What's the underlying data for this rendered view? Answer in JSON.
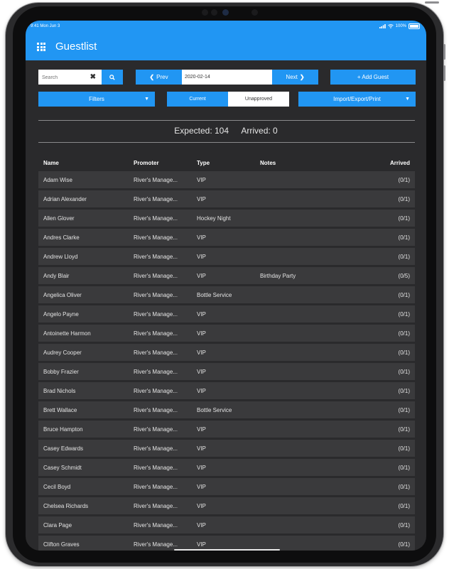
{
  "status_bar": {
    "time": "9:41 Mon Jun 3",
    "battery": "100%"
  },
  "app": {
    "title": "Guestlist"
  },
  "toolbar": {
    "search_placeholder": "Search",
    "prev_label": "Prev",
    "date_value": "2020-02-14",
    "next_label": "Next",
    "add_guest_label": "+ Add Guest",
    "filters_label": "Filters",
    "segment": {
      "current": "Current",
      "unapproved": "Unapproved",
      "selected": "Unapproved"
    },
    "import_export_label": "Import/Export/Print"
  },
  "summary": {
    "expected": "Expected: 104",
    "arrived": "Arrived: 0"
  },
  "table": {
    "headers": {
      "name": "Name",
      "promoter": "Promoter",
      "type": "Type",
      "notes": "Notes",
      "arrived": "Arrived"
    },
    "rows": [
      {
        "name": "Adam Wise",
        "promoter": "River's Manage...",
        "type": "VIP",
        "notes": "",
        "arrived": "(0/1)"
      },
      {
        "name": "Adrian Alexander",
        "promoter": "River's Manage...",
        "type": "VIP",
        "notes": "",
        "arrived": "(0/1)"
      },
      {
        "name": "Allen Glover",
        "promoter": "River's Manage...",
        "type": "Hockey Night",
        "notes": "",
        "arrived": "(0/1)"
      },
      {
        "name": "Andres Clarke",
        "promoter": "River's Manage...",
        "type": "VIP",
        "notes": "",
        "arrived": "(0/1)"
      },
      {
        "name": "Andrew Lloyd",
        "promoter": "River's Manage...",
        "type": "VIP",
        "notes": "",
        "arrived": "(0/1)"
      },
      {
        "name": "Andy Blair",
        "promoter": "River's Manage...",
        "type": "VIP",
        "notes": "Birthday Party",
        "arrived": "(0/5)"
      },
      {
        "name": "Angelica Oliver",
        "promoter": "River's Manage...",
        "type": "Bottle Service",
        "notes": "",
        "arrived": "(0/1)"
      },
      {
        "name": "Angelo Payne",
        "promoter": "River's Manage...",
        "type": "VIP",
        "notes": "",
        "arrived": "(0/1)"
      },
      {
        "name": "Antoinette Harmon",
        "promoter": "River's Manage...",
        "type": "VIP",
        "notes": "",
        "arrived": "(0/1)"
      },
      {
        "name": "Audrey Cooper",
        "promoter": "River's Manage...",
        "type": "VIP",
        "notes": "",
        "arrived": "(0/1)"
      },
      {
        "name": "Bobby Frazier",
        "promoter": "River's Manage...",
        "type": "VIP",
        "notes": "",
        "arrived": "(0/1)"
      },
      {
        "name": "Brad Nichols",
        "promoter": "River's Manage...",
        "type": "VIP",
        "notes": "",
        "arrived": "(0/1)"
      },
      {
        "name": "Brett Wallace",
        "promoter": "River's Manage...",
        "type": "Bottle Service",
        "notes": "",
        "arrived": "(0/1)"
      },
      {
        "name": "Bruce Hampton",
        "promoter": "River's Manage...",
        "type": "VIP",
        "notes": "",
        "arrived": "(0/1)"
      },
      {
        "name": "Casey Edwards",
        "promoter": "River's Manage...",
        "type": "VIP",
        "notes": "",
        "arrived": "(0/1)"
      },
      {
        "name": "Casey Schmidt",
        "promoter": "River's Manage...",
        "type": "VIP",
        "notes": "",
        "arrived": "(0/1)"
      },
      {
        "name": "Cecil Boyd",
        "promoter": "River's Manage...",
        "type": "VIP",
        "notes": "",
        "arrived": "(0/1)"
      },
      {
        "name": "Chelsea Richards",
        "promoter": "River's Manage...",
        "type": "VIP",
        "notes": "",
        "arrived": "(0/1)"
      },
      {
        "name": "Clara Page",
        "promoter": "River's Manage...",
        "type": "VIP",
        "notes": "",
        "arrived": "(0/1)"
      },
      {
        "name": "Clifton Graves",
        "promoter": "River's Manage...",
        "type": "VIP",
        "notes": "",
        "arrived": "(0/1)"
      }
    ]
  },
  "colors": {
    "accent": "#2196f3",
    "background": "#2a2a2c",
    "row": "#3a3a3c"
  },
  "icons": [
    "apps-grid-icon",
    "search-icon",
    "clear-icon",
    "chevron-left-icon",
    "chevron-right-icon",
    "dropdown-caret-icon",
    "signal-icon",
    "wifi-icon",
    "battery-icon"
  ]
}
